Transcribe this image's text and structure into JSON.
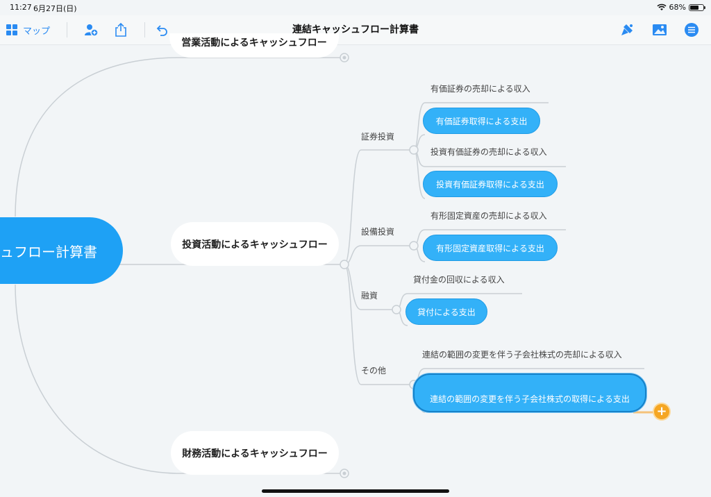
{
  "status": {
    "time": "11:27",
    "date": "6月27日(日)",
    "battery": "68%",
    "battery_level": 0.68
  },
  "toolbar": {
    "map_label": "マップ",
    "title": "連結キャッシュフロー計算書",
    "icons": [
      "grid-icon",
      "add-person-icon",
      "share-icon",
      "undo-icon",
      "format-brush-icon",
      "image-icon",
      "outline-menu-icon"
    ],
    "accent": "#2a8bf2"
  },
  "map": {
    "root": "ュフロー計算書",
    "operating": "営業活動によるキャッシュフロー",
    "investing": "投資活動によるキャッシュフロー",
    "financing": "財務活動によるキャッシュフロー",
    "groups": {
      "securities": {
        "label": "証券投資",
        "items": [
          "有価証券の売却による収入",
          "有価証券取得による支出",
          "投資有価証券の売却による収入",
          "投資有価証券取得による支出"
        ]
      },
      "equipment": {
        "label": "設備投資",
        "items": [
          "有形固定資産の売却による収入",
          "有形固定資産取得による支出"
        ]
      },
      "loans": {
        "label": "融資",
        "items": [
          "貸付金の回収による収入",
          "貸付による支出"
        ]
      },
      "other": {
        "label": "その他",
        "items": [
          "連結の範囲の変更を伴う子会社株式の売却による収入",
          "連結の範囲の変更を伴う子会社株式の取得による支出"
        ]
      }
    },
    "add_symbol": "+",
    "colors": {
      "root": "#1ea1f5",
      "expense_node": "#33b1f8",
      "add_button": "#f5a623",
      "line": "#c9cfd4"
    }
  }
}
